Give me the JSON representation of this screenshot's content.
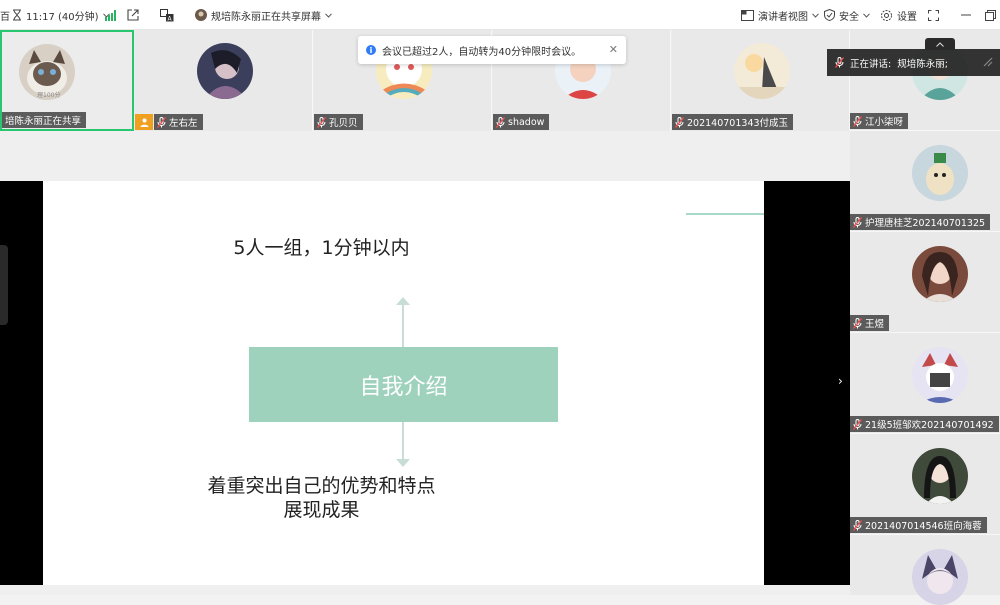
{
  "topbar": {
    "left_glyph": "百",
    "timer": "11:17 (40分钟)",
    "sharing_label": "规培陈永丽正在共享屏幕",
    "presenter_view": "演讲者视图",
    "security": "安全",
    "settings": "设置"
  },
  "toast": {
    "message": "会议已超过2人，自动转为40分钟限时会议。",
    "close": "✕"
  },
  "participants_top": [
    {
      "name": "培陈永丽正在共享",
      "avatar_text": "理100分",
      "color": "#dcd4c8"
    },
    {
      "name": "左右左",
      "color": "#3b3f5c"
    },
    {
      "name": "孔贝贝",
      "color": "#f2e3a8"
    },
    {
      "name": "shadow",
      "color": "#f1d3c2"
    },
    {
      "name": "2021407013​43付成玉",
      "color": "#efe4cf"
    }
  ],
  "participants_right": [
    {
      "name": "江小柒呀",
      "color": "#9ec9c6"
    },
    {
      "name": "护理唐桂芝202140701325",
      "color": "#c4d1d8"
    },
    {
      "name": "王煜",
      "color": "#7a4a3c"
    },
    {
      "name": "21级5班邹欢202140701492",
      "color": "#d9d6ec"
    },
    {
      "name": "2021407014546班向海蓉",
      "color": "#3f4a3a"
    },
    {
      "name": "",
      "color": "#6d6a86"
    }
  ],
  "speaking": {
    "label": "正在讲话:",
    "name": "规培陈永丽;"
  },
  "slide": {
    "title": "5人一组，1分钟以内",
    "box_label": "自我介绍",
    "body_line1": "着重突出自己的优势和特点",
    "body_line2": "展现成果"
  },
  "colors": {
    "active_border": "#28c76f",
    "accent_box": "#9ed2bd",
    "info_blue": "#2f7cf6"
  }
}
